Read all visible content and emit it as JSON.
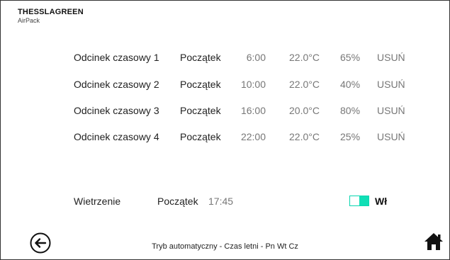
{
  "brand": {
    "name": "THESSLAGREEN",
    "product": "AirPack"
  },
  "schedule": [
    {
      "name": "Odcinek czasowy 1",
      "start_label": "Początek",
      "time": "6:00",
      "temp": "22.0°C",
      "humidity": "65%",
      "delete_label": "USUŃ"
    },
    {
      "name": "Odcinek czasowy 2",
      "start_label": "Początek",
      "time": "10:00",
      "temp": "22.0°C",
      "humidity": "40%",
      "delete_label": "USUŃ"
    },
    {
      "name": "Odcinek czasowy 3",
      "start_label": "Początek",
      "time": "16:00",
      "temp": "20.0°C",
      "humidity": "80%",
      "delete_label": "USUŃ"
    },
    {
      "name": "Odcinek czasowy 4",
      "start_label": "Początek",
      "time": "22:00",
      "temp": "22.0°C",
      "humidity": "25%",
      "delete_label": "USUŃ"
    }
  ],
  "ventilation": {
    "label": "Wietrzenie",
    "start_label": "Początek",
    "time": "17:45",
    "toggle_state": "on",
    "toggle_label": "Wł",
    "toggle_color": "#10dfb6"
  },
  "footer": {
    "status": "Tryb automatyczny - Czas letni - Pn Wt Cz",
    "back_icon": "back-arrow-icon",
    "home_icon": "home-icon"
  }
}
